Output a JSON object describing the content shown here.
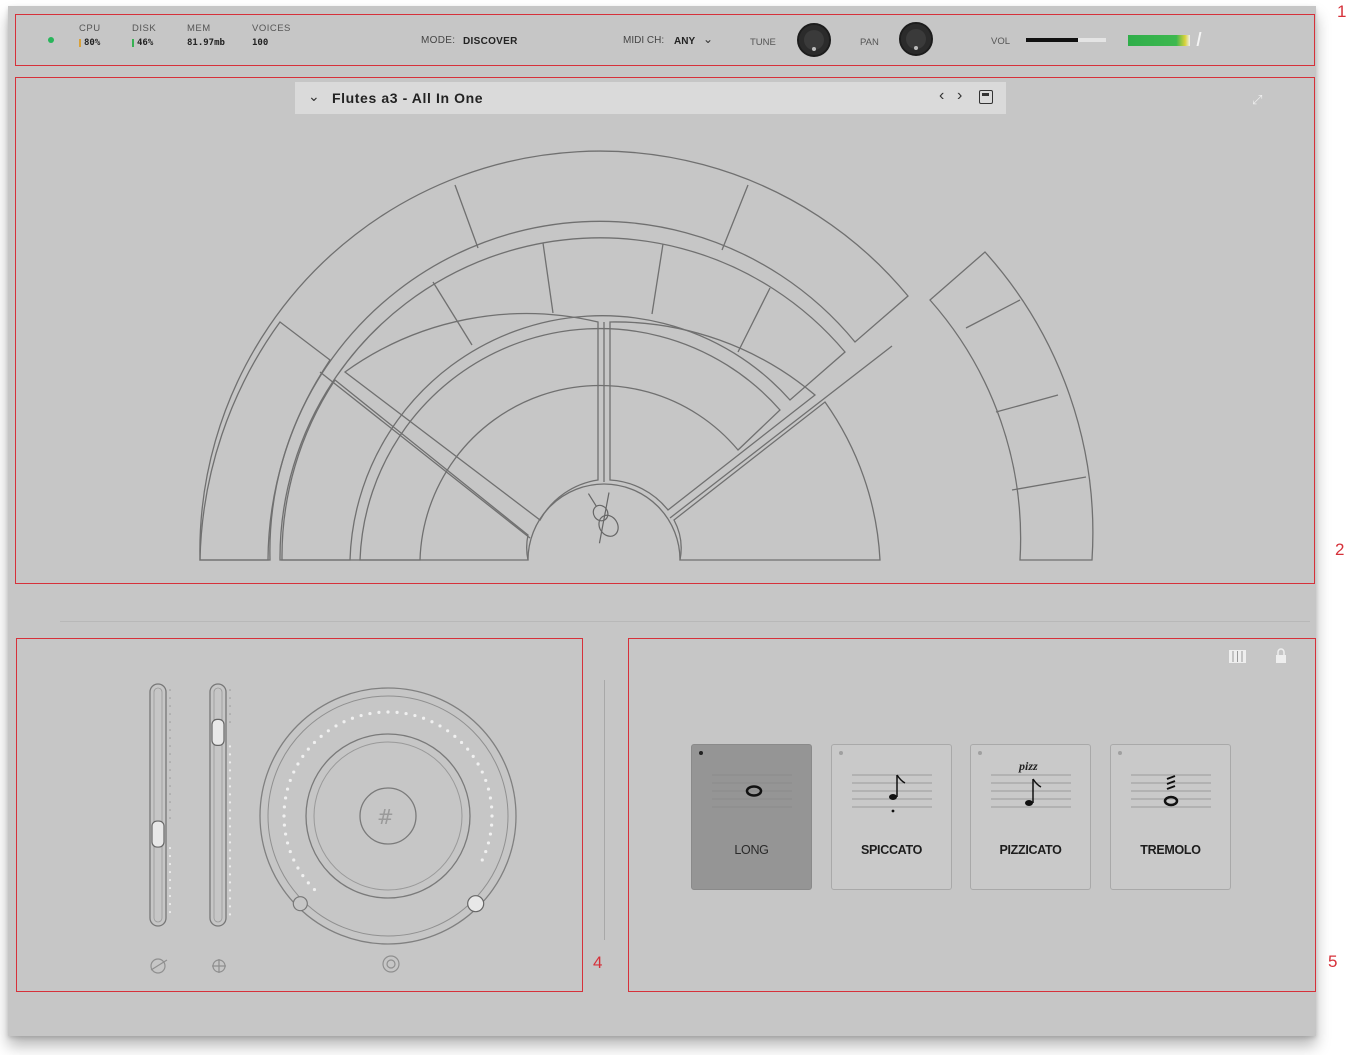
{
  "callouts": {
    "top": "1",
    "main": "2",
    "controls": "4",
    "articulations": "5"
  },
  "status": {
    "cpu": {
      "label": "CPU",
      "value": "80%",
      "color": "#d9a13a"
    },
    "disk": {
      "label": "DISK",
      "value": "46%",
      "color": "#36b152"
    },
    "mem": {
      "label": "MEM",
      "value": "81.97mb"
    },
    "voices": {
      "label": "VOICES",
      "value": "100"
    }
  },
  "mode": {
    "label": "MODE:",
    "value": "DISCOVER"
  },
  "midi": {
    "label": "MIDI CH:",
    "value": "ANY"
  },
  "tune": {
    "label": "TUNE"
  },
  "pan": {
    "label": "PAN"
  },
  "vol": {
    "label": "VOL",
    "level": 0.65
  },
  "meter": {
    "level": 0.92
  },
  "preset": {
    "name": "Flutes a3 - All In One"
  },
  "icons": {
    "expand": "expand-icon",
    "save": "save-icon",
    "violin": "violin-icon",
    "keyboard": "keyboard-icon",
    "lock": "lock-icon"
  },
  "sliders": [
    {
      "name": "expression",
      "value": 0.38
    },
    {
      "name": "dynamics",
      "value": 0.8
    }
  ],
  "dial": {
    "value": 0.94
  },
  "articulations": [
    {
      "label": "LONG",
      "active": true
    },
    {
      "label": "SPICCATO",
      "active": false
    },
    {
      "label": "PIZZICATO",
      "active": false,
      "mark": "pizz"
    },
    {
      "label": "TREMOLO",
      "active": false
    }
  ]
}
